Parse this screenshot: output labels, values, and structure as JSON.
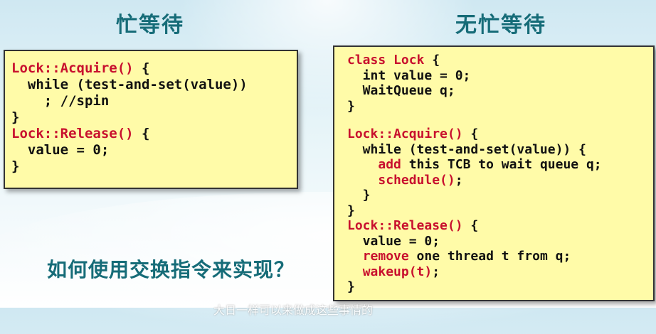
{
  "headings": {
    "left": "忙等待",
    "right": "无忙等待"
  },
  "left_code": [
    [
      {
        "t": "Lock::Acquire()",
        "c": "kw"
      },
      {
        "t": " {",
        "c": ""
      }
    ],
    [
      {
        "t": "  while (test-and-set(value))",
        "c": ""
      }
    ],
    [
      {
        "t": "    ; //spin",
        "c": ""
      }
    ],
    [
      {
        "t": "}",
        "c": ""
      }
    ],
    [
      {
        "t": "Lock::Release()",
        "c": "kw"
      },
      {
        "t": " {",
        "c": ""
      }
    ],
    [
      {
        "t": "  value = 0;",
        "c": ""
      }
    ],
    [
      {
        "t": "}",
        "c": ""
      }
    ]
  ],
  "right_code": [
    [
      {
        "t": "class Lock",
        "c": "kw"
      },
      {
        "t": " {",
        "c": ""
      }
    ],
    [
      {
        "t": "  int value = 0;",
        "c": ""
      }
    ],
    [
      {
        "t": "  WaitQueue q;",
        "c": ""
      }
    ],
    [
      {
        "t": "}",
        "c": ""
      }
    ],
    [
      {
        "t": "",
        "c": ""
      }
    ],
    [
      {
        "t": "Lock::Acquire()",
        "c": "kw"
      },
      {
        "t": " {",
        "c": ""
      }
    ],
    [
      {
        "t": "  while (test-and-set(value)) {",
        "c": ""
      }
    ],
    [
      {
        "t": "    ",
        "c": ""
      },
      {
        "t": "add",
        "c": "kw"
      },
      {
        "t": " this TCB to wait queue q;",
        "c": ""
      }
    ],
    [
      {
        "t": "    ",
        "c": ""
      },
      {
        "t": "schedule()",
        "c": "kw"
      },
      {
        "t": ";",
        "c": ""
      }
    ],
    [
      {
        "t": "  }",
        "c": ""
      }
    ],
    [
      {
        "t": "}",
        "c": ""
      }
    ],
    [
      {
        "t": "Lock::Release()",
        "c": "kw"
      },
      {
        "t": " {",
        "c": ""
      }
    ],
    [
      {
        "t": "  value = 0;",
        "c": ""
      }
    ],
    [
      {
        "t": "  ",
        "c": ""
      },
      {
        "t": "remove",
        "c": "kw"
      },
      {
        "t": " one thread t from q;",
        "c": ""
      }
    ],
    [
      {
        "t": "  ",
        "c": ""
      },
      {
        "t": "wakeup(t)",
        "c": "kw"
      },
      {
        "t": ";",
        "c": ""
      }
    ],
    [
      {
        "t": "}",
        "c": ""
      }
    ]
  ],
  "question": "如何使用交换指令来实现？",
  "subtitle": "大日一样可以来做成这些事情的",
  "colors": {
    "heading": "#166c78",
    "keyword": "#c8102e",
    "box": "#fffba8"
  }
}
